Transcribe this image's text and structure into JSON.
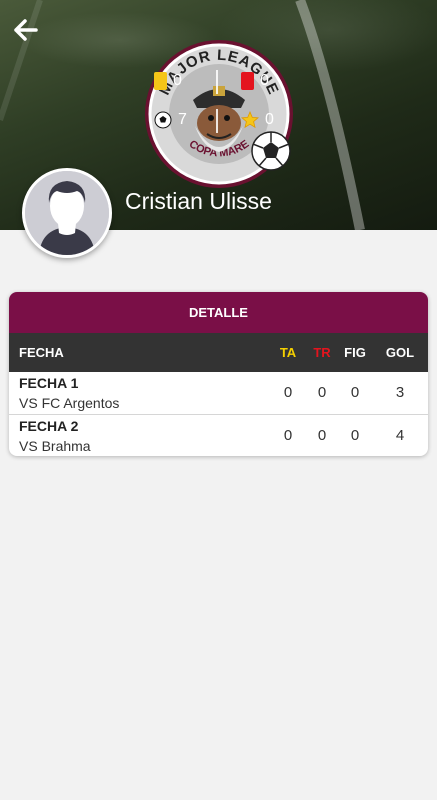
{
  "header": {
    "player_name": "Cristian Ulisse",
    "logo_top_text": "MAJOR LEAGUE",
    "logo_bottom_text": "COPA MARE",
    "stats": {
      "yellow_cards": "0",
      "red_cards": "0",
      "goals": "7",
      "mvp": "0"
    },
    "icons": [
      "back-arrow-icon",
      "yellow-card-icon",
      "red-card-icon",
      "soccer-ball-icon",
      "star-icon",
      "avatar-silhouette"
    ]
  },
  "detail": {
    "title": "DETALLE",
    "columns": {
      "fecha": "FECHA",
      "ta": "TA",
      "tr": "TR",
      "fig": "FIG",
      "gol": "GOL"
    },
    "rows": [
      {
        "fecha": "FECHA 1",
        "opponent": "VS FC Argentos",
        "ta": "0",
        "tr": "0",
        "fig": "0",
        "gol": "3"
      },
      {
        "fecha": "FECHA 2",
        "opponent": "VS Brahma",
        "ta": "0",
        "tr": "0",
        "fig": "0",
        "gol": "4"
      }
    ]
  },
  "colors": {
    "accent": "#7a0f47",
    "table_header": "#333333",
    "ta": "#f5d000",
    "tr": "#e4141e"
  }
}
